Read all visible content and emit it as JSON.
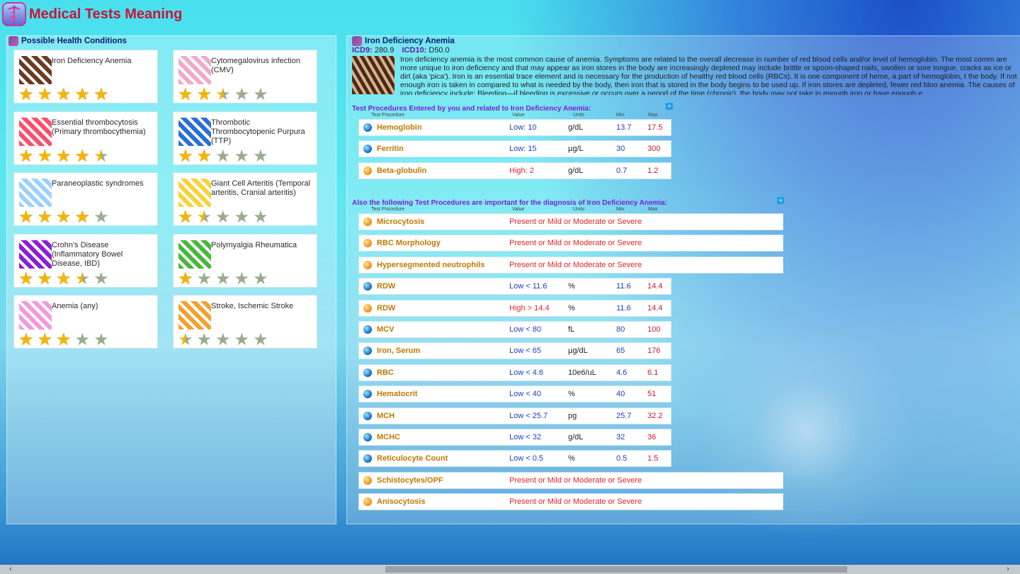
{
  "app": {
    "title": "Medical Tests Meaning"
  },
  "conditions": {
    "title": "Possible Health Conditions",
    "items": [
      {
        "name": "Iron Deficiency Anemia",
        "rating": 5
      },
      {
        "name": "Cytomegalovirus infection (CMV)",
        "rating": 2.5
      },
      {
        "name": "Essential thrombocytosis (Primary thrombocythemia)",
        "rating": 4.5
      },
      {
        "name": "Thrombotic Thrombocytopenic Purpura (TTP)",
        "rating": 2
      },
      {
        "name": "Paraneoplastic syndromes",
        "rating": 4
      },
      {
        "name": "Giant Cell Arteritis (Temporal arteritis, Cranial arteritis)",
        "rating": 1.5
      },
      {
        "name": "Crohn's Disease (Inflammatory Bowel Disease, IBD)",
        "rating": 3.5
      },
      {
        "name": "Polymyalgia Rheumatica",
        "rating": 1
      },
      {
        "name": "Anemia (any)",
        "rating": 3
      },
      {
        "name": "Stroke, Ischemic Stroke",
        "rating": 0.5
      }
    ]
  },
  "detail": {
    "title": "Iron Deficiency Anemia",
    "icd9_label": "ICD9:",
    "icd9_value": "280.9",
    "icd10_label": "ICD10:",
    "icd10_value": "D50.0",
    "description": "Iron deficiency anemia is the most common cause of anemia. Symptoms are related to the overall decrease in number of red blood cells and/or level of hemoglobin. The most comm are more unique to iron deficiency and that may appear as iron stores in the body are increasingly depleted may include brittle or spoon-shaped nails, swollen or sore tongue, cracks as ice or dirt (aka 'pica'). Iron is an essential trace element and is necessary for the production of healthy red blood cells (RBCs). It is one component of heme, a part of hemoglobin, t the body. If not enough iron is taken in compared to what is needed by the body, then iron that is stored in the body begins to be used up. If iron stores are depleted, fewer red bloo anemia. The causes of iron deficiency include: Bleeding—if bleeding is excessive or occurs over a period of the time (chronic), the body may not take in enough iron or have enough e"
  },
  "columns": {
    "test": "Test Procedure",
    "value": "Value",
    "units": "Units",
    "min": "Min",
    "max": "Max"
  },
  "entered": {
    "title": "Test Procedures Entered by you and related to Iron Deficiency Anemia:",
    "rows": [
      {
        "name": "Hemoglobin",
        "value": "Low: 10",
        "kind": "low",
        "units": "g/dL",
        "min": "13.7",
        "max": "17.5",
        "icon": "blue"
      },
      {
        "name": "Ferritin",
        "value": "Low: 15",
        "kind": "low",
        "units": "µg/L",
        "min": "30",
        "max": "300",
        "icon": "blue"
      },
      {
        "name": "Beta-globulin",
        "value": "High: 2",
        "kind": "high",
        "units": "g/dL",
        "min": "0.7",
        "max": "1.2",
        "icon": "orange"
      }
    ]
  },
  "also": {
    "title": "Also the following Test Procedures are important for the diagnosis of Iron Deficiency Anemia:",
    "rows": [
      {
        "name": "Microcytosis",
        "value": "Present or Mild or Moderate or Severe",
        "kind": "pres",
        "units": "",
        "min": "",
        "max": "",
        "icon": "orange",
        "wide": true
      },
      {
        "name": "RBC Morphology",
        "value": "Present or Mild or Moderate or Severe",
        "kind": "pres",
        "units": "",
        "min": "",
        "max": "",
        "icon": "orange",
        "wide": true
      },
      {
        "name": "Hypersegmented neutrophils",
        "value": "Present or Mild or Moderate or Severe",
        "kind": "pres",
        "units": "",
        "min": "",
        "max": "",
        "icon": "orange",
        "wide": true
      },
      {
        "name": "RDW",
        "value": "Low < 11.6",
        "kind": "low",
        "units": "%",
        "min": "11.6",
        "max": "14.4",
        "icon": "blue"
      },
      {
        "name": "RDW",
        "value": "High > 14.4",
        "kind": "high",
        "units": "%",
        "min": "11.6",
        "max": "14.4",
        "icon": "orange"
      },
      {
        "name": "MCV",
        "value": "Low < 80",
        "kind": "low",
        "units": "fL",
        "min": "80",
        "max": "100",
        "icon": "blue"
      },
      {
        "name": "Iron, Serum",
        "value": "Low < 65",
        "kind": "low",
        "units": "µg/dL",
        "min": "65",
        "max": "176",
        "icon": "blue"
      },
      {
        "name": "RBC",
        "value": "Low < 4.6",
        "kind": "low",
        "units": "10e6/uL",
        "min": "4.6",
        "max": "6.1",
        "icon": "blue"
      },
      {
        "name": "Hematocrit",
        "value": "Low < 40",
        "kind": "low",
        "units": "%",
        "min": "40",
        "max": "51",
        "icon": "blue"
      },
      {
        "name": "MCH",
        "value": "Low < 25.7",
        "kind": "low",
        "units": "pg",
        "min": "25.7",
        "max": "32.2",
        "icon": "blue"
      },
      {
        "name": "MCHC",
        "value": "Low < 32",
        "kind": "low",
        "units": "g/dL",
        "min": "32",
        "max": "36",
        "icon": "blue"
      },
      {
        "name": "Reticulocyte Count",
        "value": "Low < 0.5",
        "kind": "low",
        "units": "%",
        "min": "0.5",
        "max": "1.5",
        "icon": "blue"
      },
      {
        "name": "Schistocytes/OPF",
        "value": "Present or Mild or Moderate or Severe",
        "kind": "pres",
        "units": "",
        "min": "",
        "max": "",
        "icon": "orange",
        "wide": true
      },
      {
        "name": "Anisocytosis",
        "value": "Present or Mild or Moderate or Severe",
        "kind": "pres",
        "units": "",
        "min": "",
        "max": "",
        "icon": "orange",
        "wide": true
      }
    ]
  },
  "thumb_colors": [
    "#6b3a20",
    "#f2a8c8",
    "#ff4d6d",
    "#2a6fd6",
    "#9bd0ff",
    "#f7d23a",
    "#8a1fd6",
    "#46b83a",
    "#f29ad8",
    "#f4a030"
  ],
  "scroll": {
    "left_arrow": "‹",
    "right_arrow": "›"
  }
}
